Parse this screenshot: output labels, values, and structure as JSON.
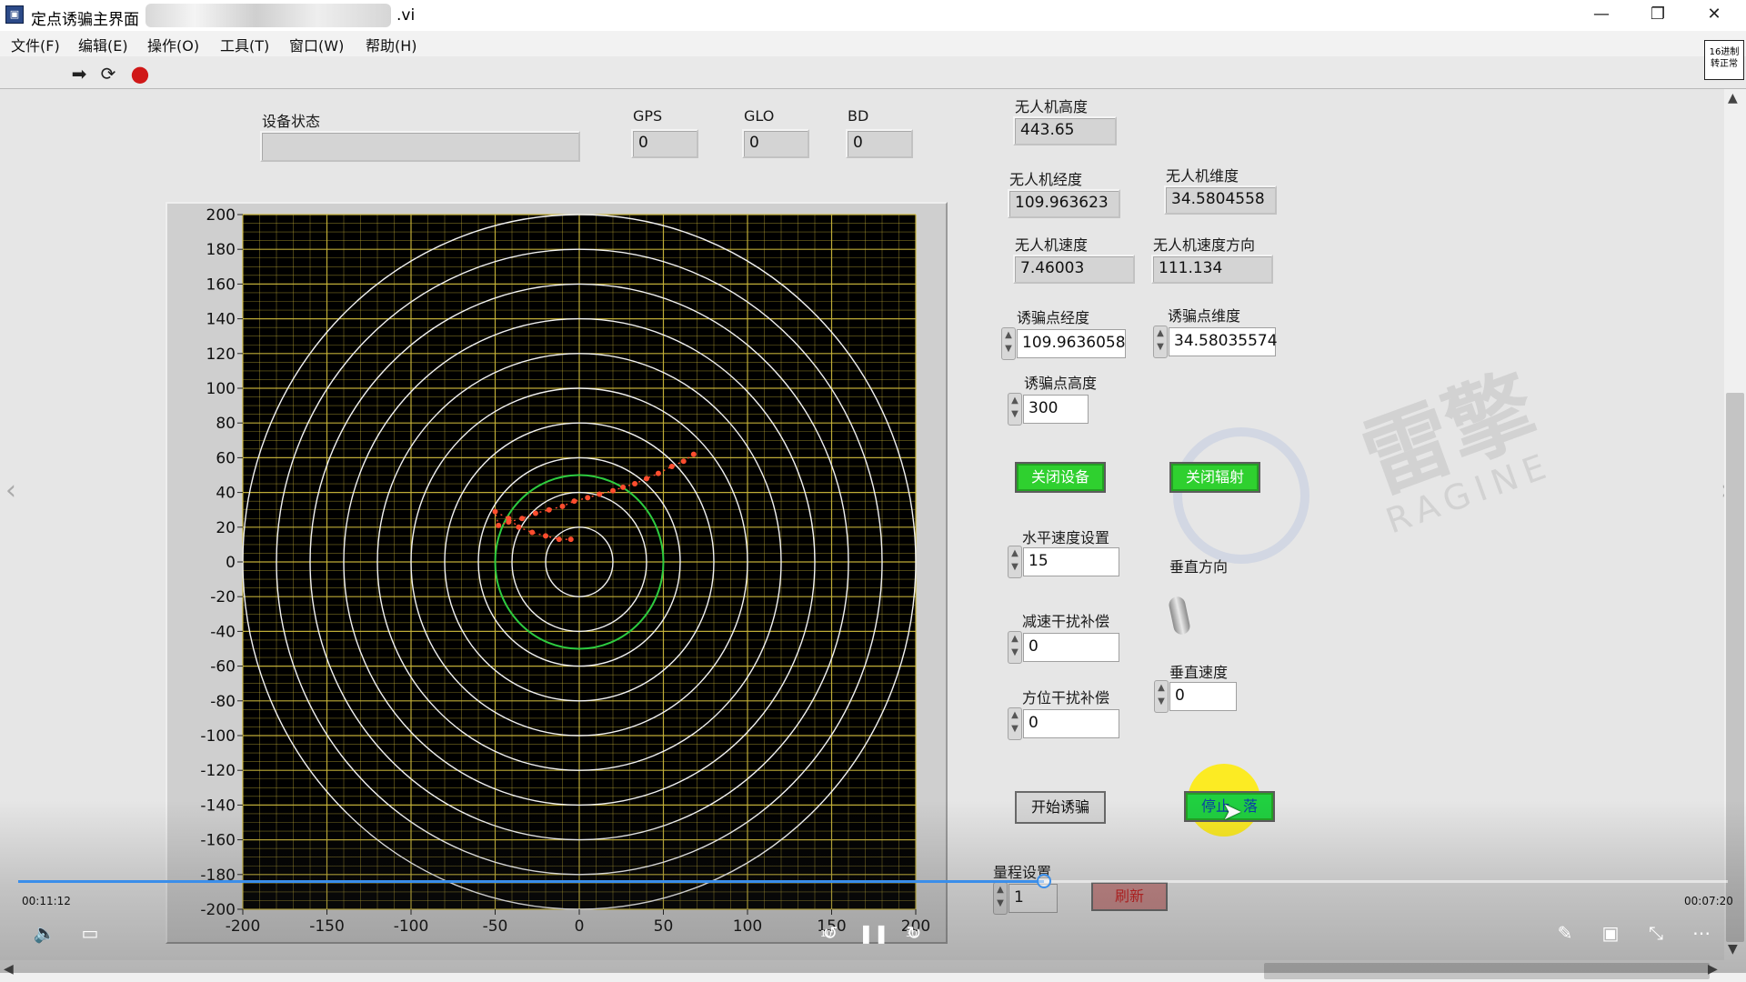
{
  "window": {
    "title": "定点诱骗主界面",
    "title_ext": ".vi",
    "controls": {
      "minimize": "—",
      "restore": "❐",
      "close": "✕"
    }
  },
  "menu": [
    "文件(F)",
    "编辑(E)",
    "操作(O)",
    "工具(T)",
    "窗口(W)",
    "帮助(H)"
  ],
  "toolbar": {
    "run": "➡",
    "run_continuous": "⟳",
    "abort": "●"
  },
  "corner_icon_text": "16进制 转正常",
  "status": {
    "device_label": "设备状态",
    "device_value": "",
    "gps_label": "GPS",
    "gps_value": "0",
    "glo_label": "GLO",
    "glo_value": "0",
    "bd_label": "BD",
    "bd_value": "0"
  },
  "uav": {
    "alt_label": "无人机高度",
    "alt_value": "443.65",
    "lon_label": "无人机经度",
    "lon_value": "109.963623",
    "lat_label": "无人机维度",
    "lat_value": "34.5804558",
    "speed_label": "无人机速度",
    "speed_value": "7.46003",
    "dir_label": "无人机速度方向",
    "dir_value": "111.134"
  },
  "decoy": {
    "lon_label": "诱骗点经度",
    "lon_value": "109.9636058",
    "lat_label": "诱骗点维度",
    "lat_value": "34.58035574",
    "alt_label": "诱骗点高度",
    "alt_value": "300"
  },
  "buttons": {
    "close_device": "关闭设备",
    "close_radiation": "关闭辐射",
    "start_decoy": "开始诱骗",
    "stop_landing": "停止",
    "stop_landing_tail": "落",
    "refresh": "刷新"
  },
  "settings": {
    "hspeed_label": "水平速度设置",
    "hspeed_value": "15",
    "vdir_label": "垂直方向",
    "decel_label": "减速干扰补偿",
    "decel_value": "0",
    "vspeed_label": "垂直速度",
    "vspeed_value": "0",
    "azimuth_label": "方位干扰补偿",
    "azimuth_value": "0",
    "range_label": "量程设置",
    "range_value": "1"
  },
  "watermark": {
    "cn": "雷擎",
    "en": "RAGINE"
  },
  "player": {
    "elapsed": "00:11:12",
    "remaining": "00:07:20",
    "progress": 0.6,
    "skip_back_label": "10",
    "skip_fwd_label": "30"
  },
  "chart_data": {
    "type": "scatter",
    "title": "",
    "xlabel": "",
    "ylabel": "",
    "xlim": [
      -200,
      200
    ],
    "ylim": [
      -200,
      200
    ],
    "xticks": [
      -200,
      -150,
      -100,
      -50,
      0,
      50,
      100,
      150,
      200
    ],
    "yticks": [
      200,
      180,
      160,
      140,
      120,
      100,
      80,
      60,
      40,
      20,
      0,
      -20,
      -40,
      -60,
      -80,
      -100,
      -120,
      -140,
      -160,
      -180,
      -200
    ],
    "grid": true,
    "background": "#000000",
    "grid_color": "#c9b53a",
    "range_rings": {
      "radii": [
        20,
        40,
        60,
        80,
        100,
        120,
        140,
        160,
        180,
        200
      ],
      "color": "#f2f2f2"
    },
    "highlight_ring": {
      "radius": 50,
      "color": "#2ecc40"
    },
    "series": [
      {
        "color": "#ff4d2e",
        "points": [
          [
            68,
            62
          ],
          [
            62,
            58
          ],
          [
            55,
            55
          ],
          [
            47,
            51
          ],
          [
            40,
            48
          ],
          [
            33,
            45
          ],
          [
            26,
            43
          ],
          [
            20,
            41
          ],
          [
            12,
            39
          ],
          [
            5,
            37
          ],
          [
            -3,
            35
          ],
          [
            -10,
            32
          ],
          [
            -18,
            30
          ],
          [
            -26,
            28
          ],
          [
            -34,
            25
          ],
          [
            -42,
            23
          ],
          [
            -48,
            21
          ],
          [
            -50,
            29
          ],
          [
            -42,
            25
          ],
          [
            -36,
            20
          ],
          [
            -28,
            17
          ],
          [
            -20,
            15
          ],
          [
            -12,
            13
          ],
          [
            -5,
            13
          ]
        ]
      }
    ]
  }
}
